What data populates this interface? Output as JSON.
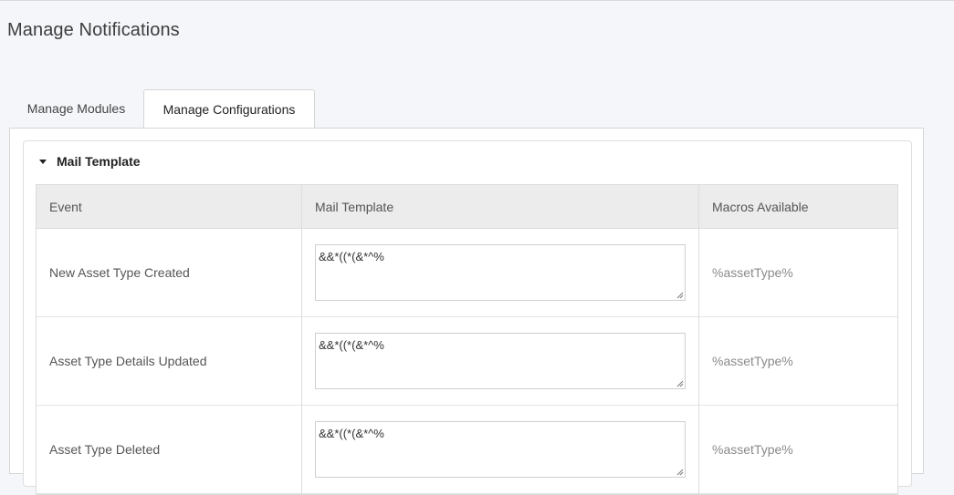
{
  "page": {
    "title": "Manage Notifications"
  },
  "tabs": [
    {
      "label": "Manage Modules",
      "active": false
    },
    {
      "label": "Manage Configurations",
      "active": true
    }
  ],
  "section": {
    "title": "Mail Template",
    "expanded": true
  },
  "table": {
    "columns": [
      "Event",
      "Mail Template",
      "Macros Available"
    ],
    "rows": [
      {
        "event": "New Asset Type Created",
        "template": "&&*((*(&*^%",
        "macros": "%assetType%"
      },
      {
        "event": "Asset Type Details Updated",
        "template": "&&*((*(&*^%",
        "macros": "%assetType%"
      },
      {
        "event": "Asset Type Deleted",
        "template": "&&*((*(&*^%",
        "macros": "%assetType%"
      }
    ]
  },
  "colors": {
    "background": "#f5f6fa",
    "header_bg": "#ececec",
    "macro_text": "#8a8a8a"
  }
}
